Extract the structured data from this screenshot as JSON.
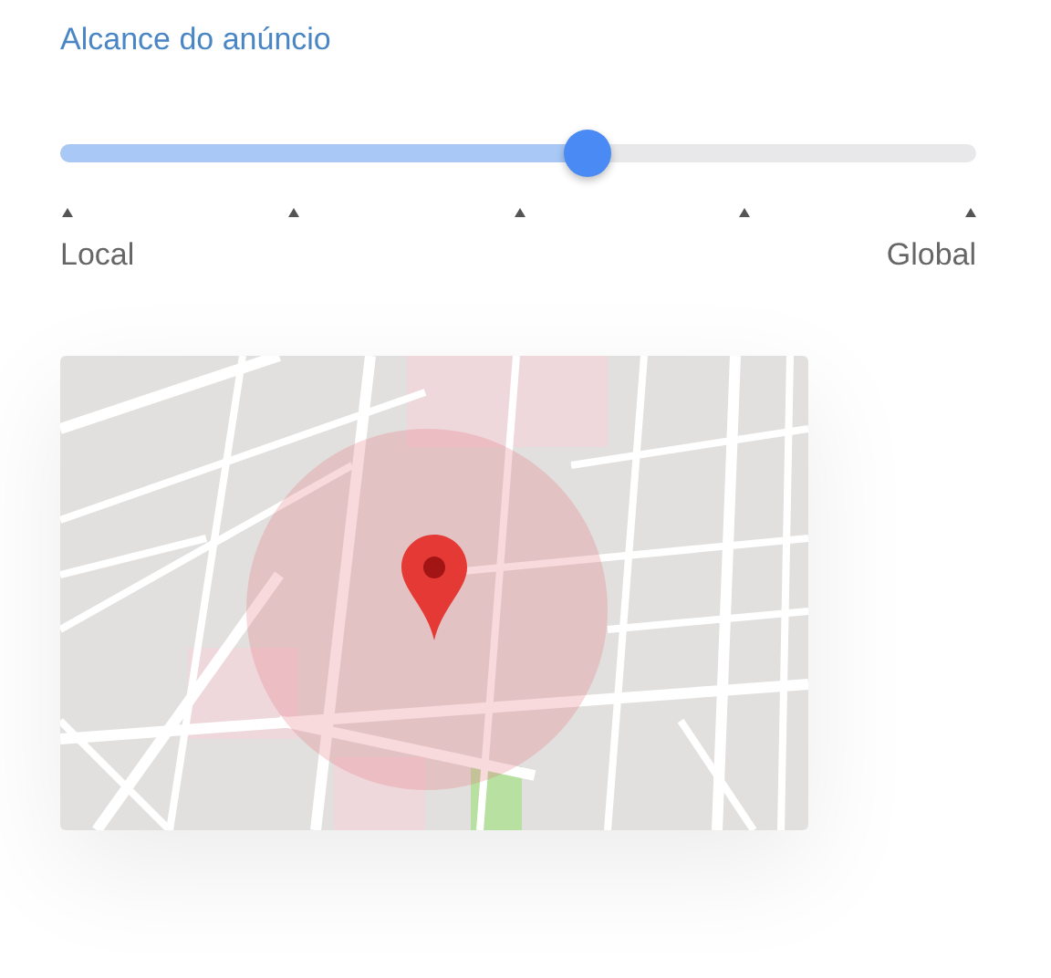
{
  "title": "Alcance do anúncio",
  "slider": {
    "level": 0.576,
    "min_label": "Local",
    "max_label": "Global"
  }
}
